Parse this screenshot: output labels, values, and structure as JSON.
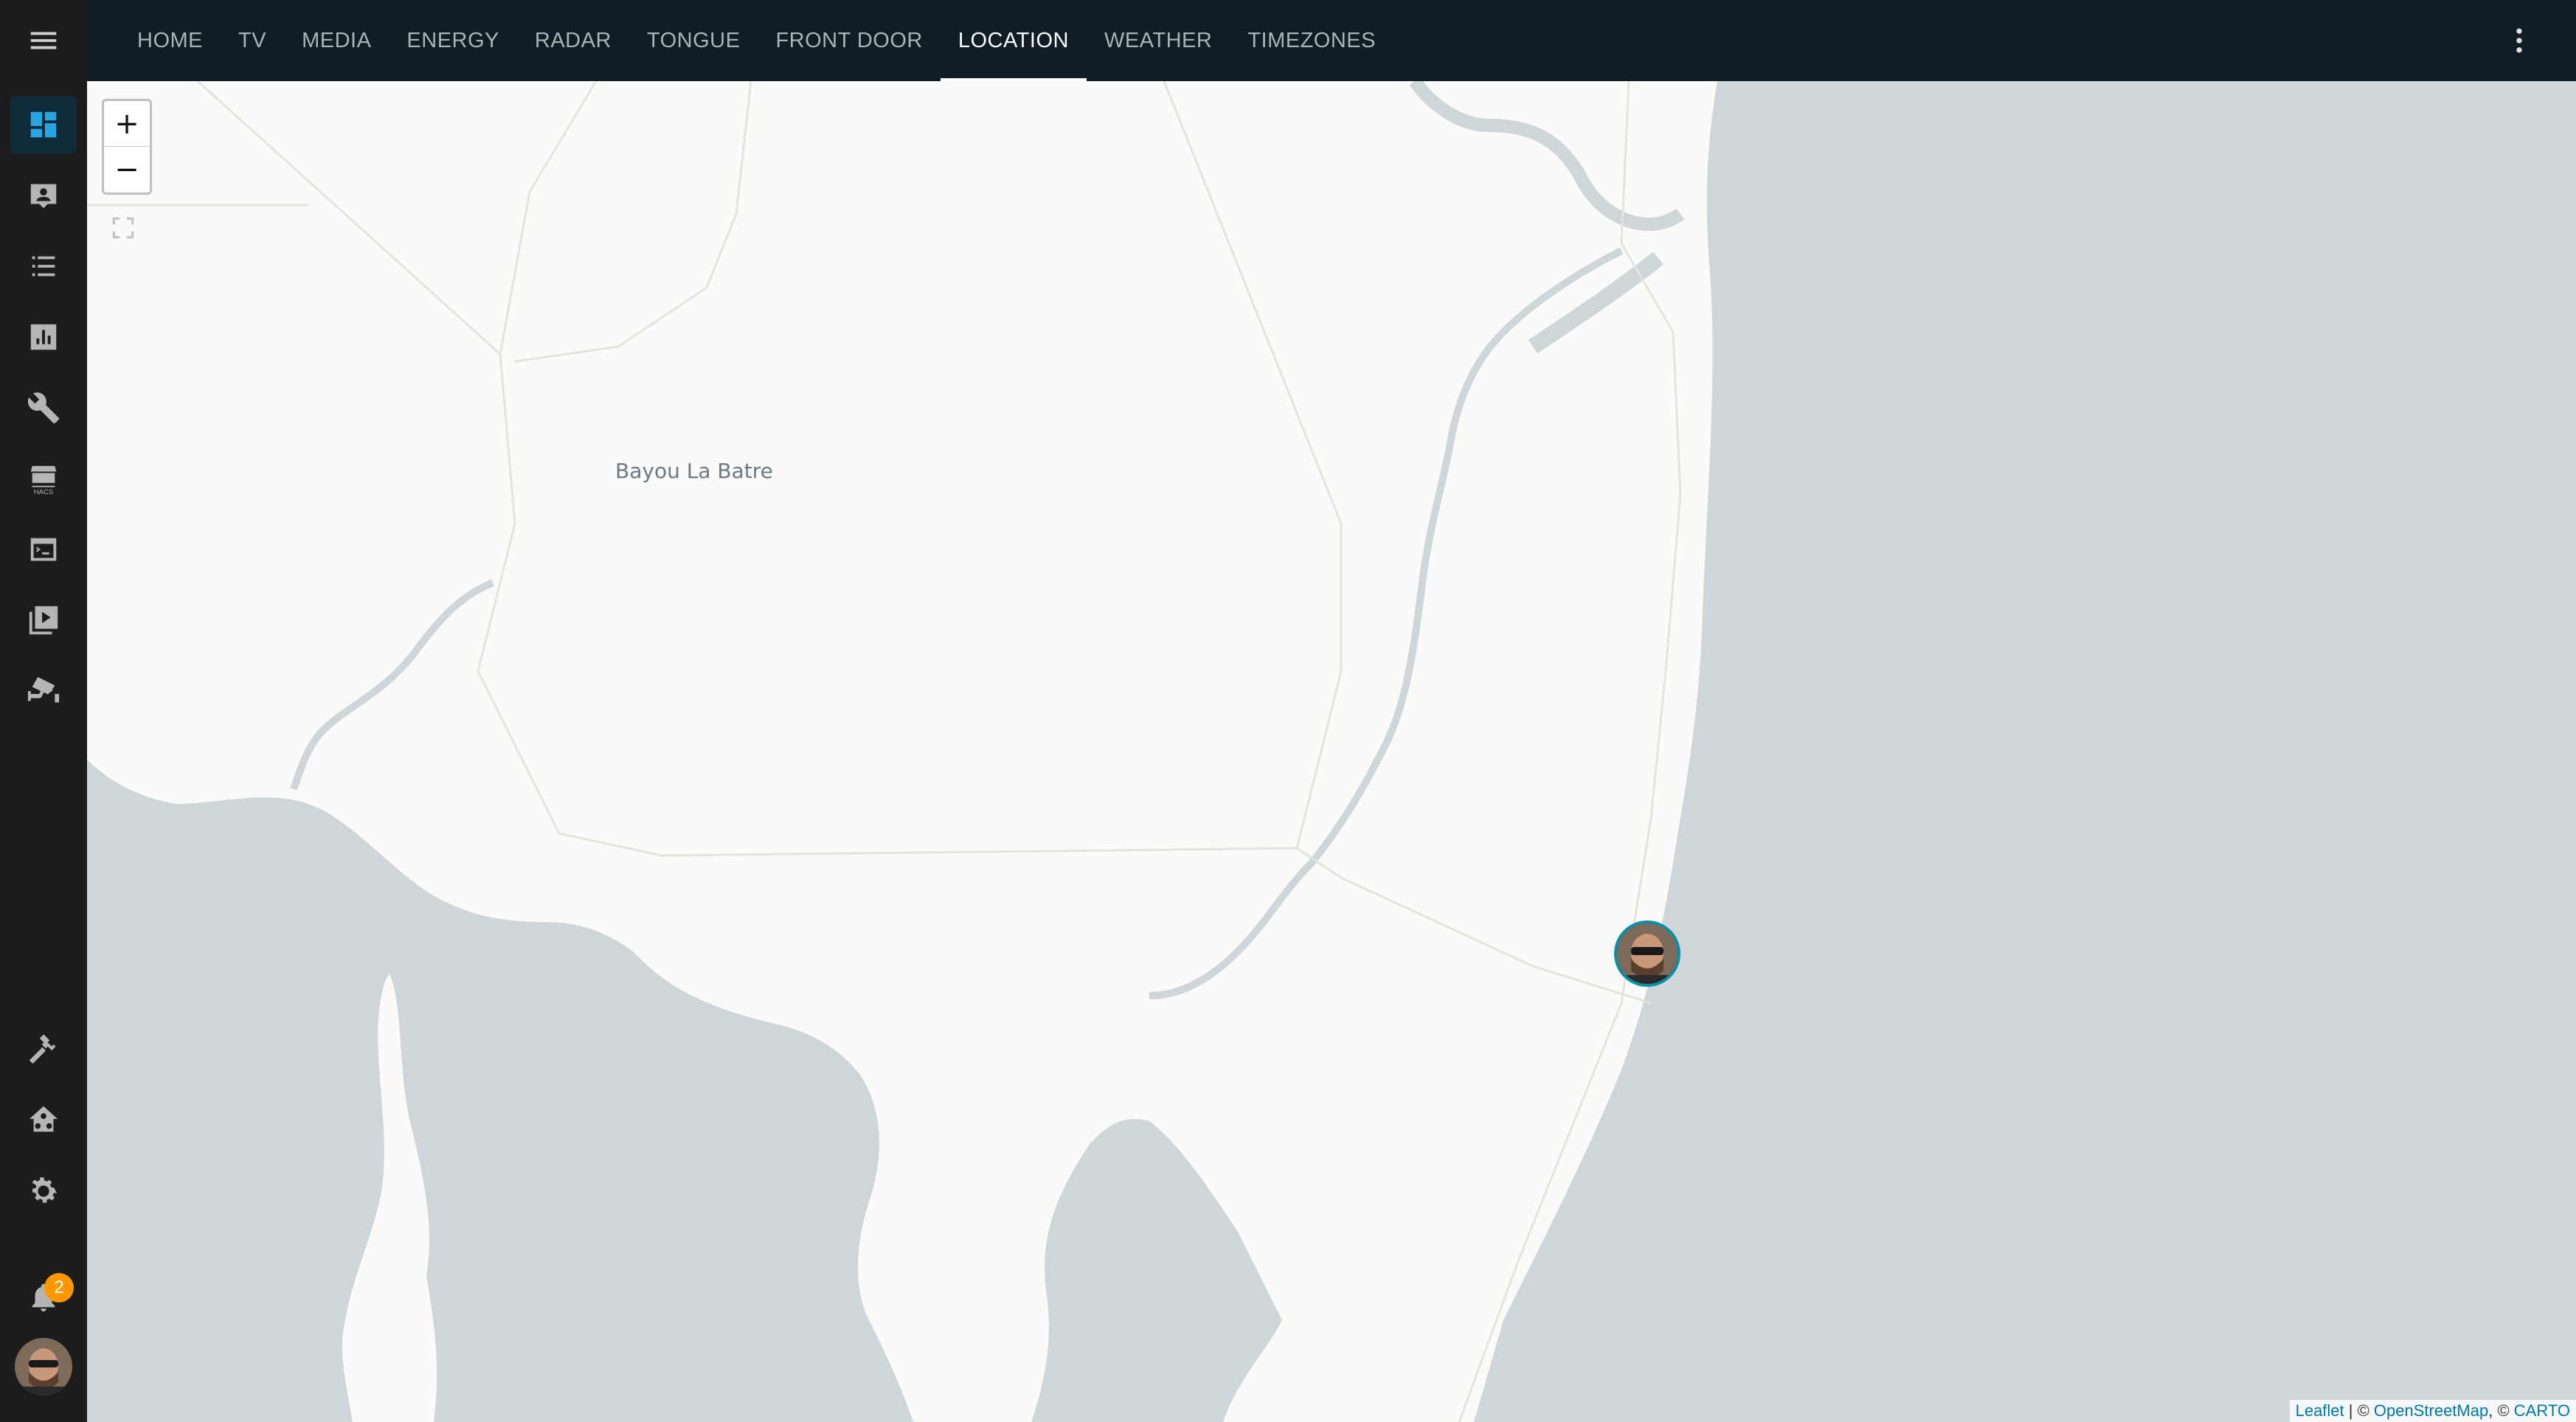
{
  "sidebar": {
    "items": [
      {
        "name": "menu",
        "icon": "hamburger-menu-icon"
      },
      {
        "name": "overview",
        "icon": "dashboard-icon",
        "active": true
      },
      {
        "name": "map",
        "icon": "account-box-icon"
      },
      {
        "name": "logbook",
        "icon": "format-list-bulleted-icon"
      },
      {
        "name": "history",
        "icon": "chart-box-icon"
      },
      {
        "name": "tools",
        "icon": "wrench-icon"
      },
      {
        "name": "hacs",
        "icon": "hacs-store-icon",
        "label": "HACS"
      },
      {
        "name": "terminal",
        "icon": "console-icon"
      },
      {
        "name": "media",
        "icon": "play-box-multiple-icon"
      },
      {
        "name": "frigate",
        "icon": "cctv-icon"
      },
      {
        "name": "developer-tools",
        "icon": "hammer-icon"
      },
      {
        "name": "home-assistant",
        "icon": "home-assistant-icon"
      },
      {
        "name": "settings",
        "icon": "cog-icon"
      },
      {
        "name": "notifications",
        "icon": "bell-icon"
      }
    ],
    "notification_count": "2",
    "accent_color": "#29a6e0"
  },
  "topbar": {
    "tabs": [
      "HOME",
      "TV",
      "MEDIA",
      "ENERGY",
      "RADAR",
      "TONGUE",
      "FRONT DOOR",
      "LOCATION",
      "WEATHER",
      "TIMEZONES"
    ],
    "active_tab": "LOCATION",
    "overflow_icon": "dots-vertical-icon"
  },
  "map": {
    "zoom_in_label": "+",
    "zoom_out_label": "−",
    "place_label": "Bayou La Batre",
    "marker_icon": "person-avatar-icon",
    "attribution": {
      "leaflet": "Leaflet",
      "sep1": " | © ",
      "osm": "OpenStreetMap",
      "sep2": ", © ",
      "carto": "CARTO"
    },
    "water_color": "#cfd6d9",
    "land_color": "#fafaf8"
  }
}
